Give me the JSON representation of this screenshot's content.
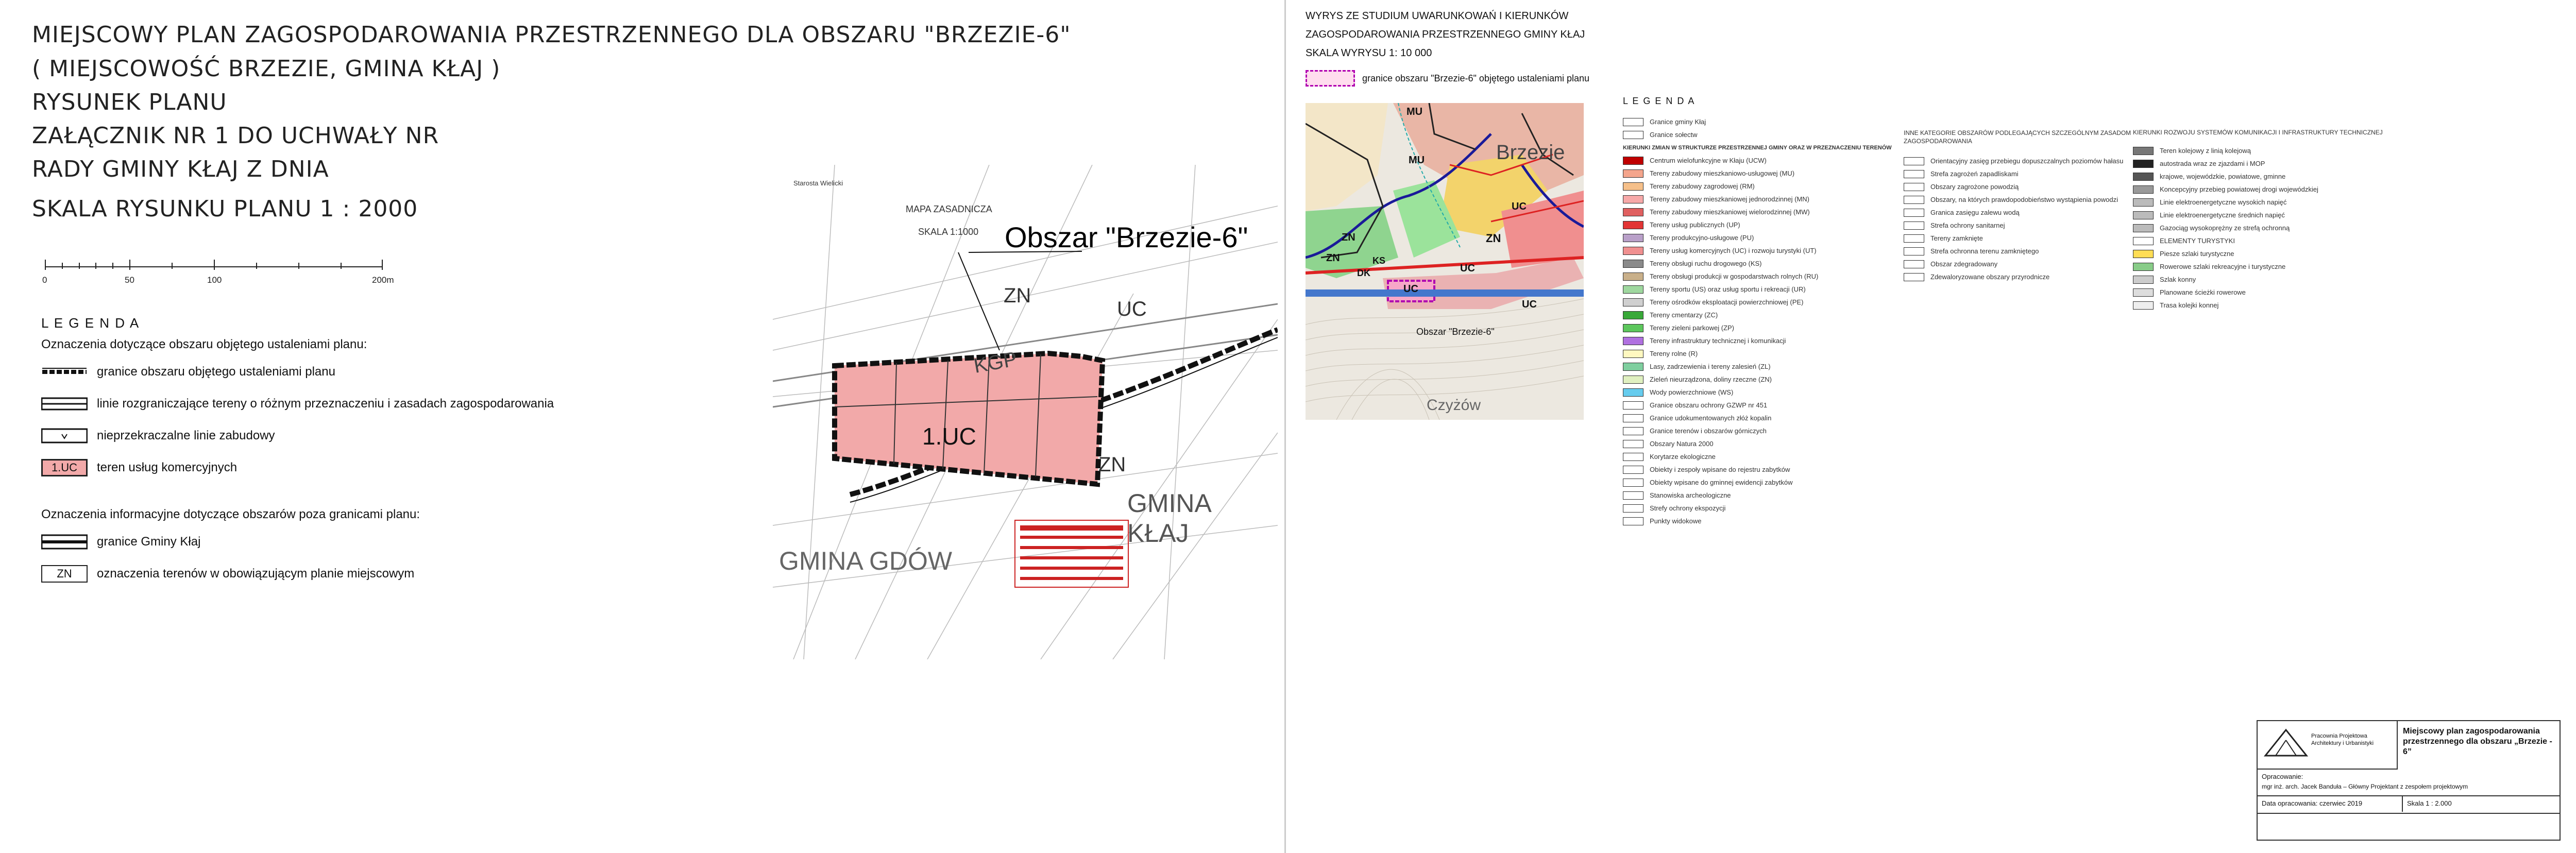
{
  "left_title": {
    "line1": "MIEJSCOWY PLAN ZAGOSPODAROWANIA PRZESTRZENNEGO  DLA OBSZARU \"BRZEZIE-6\"",
    "line2": "( MIEJSCOWOŚĆ BRZEZIE, GMINA KŁAJ )",
    "line3": "RYSUNEK PLANU",
    "line4": "ZAŁĄCZNIK NR 1 DO UCHWAŁY NR",
    "line5": "RADY GMINY KŁAJ Z DNIA",
    "line6": "SKALA RYSUNKU PLANU 1 : 2000"
  },
  "scale_bar": {
    "ticks": [
      "0",
      "50",
      "100",
      "200m"
    ]
  },
  "legend_left": {
    "heading": "L E G E N D A",
    "group1_title": "Oznaczenia dotyczące obszaru objętego ustaleniami planu:",
    "items1": [
      {
        "label": "granice obszaru objętego ustaleniami planu"
      },
      {
        "label": "linie rozgraniczające tereny o różnym przeznaczeniu i zasadach zagospodarowania"
      },
      {
        "label": "nieprzekraczalne linie zabudowy"
      },
      {
        "label": "teren usług komercyjnych",
        "code": "1.UC"
      }
    ],
    "group2_title": "Oznaczenia informacyjne dotyczące obszarów poza granicami planu:",
    "items2": [
      {
        "label": "granice Gminy Kłaj"
      },
      {
        "label": "oznaczenia terenów w obowiązującym planie miejscowym",
        "code": "ZN"
      }
    ]
  },
  "map_main": {
    "callout": "Obszar \"Brzezie-6\"",
    "zone_code": "1.UC",
    "labels": [
      "ZN",
      "UC",
      "KGP",
      "ZN",
      "GMINA KŁAJ",
      "GMINA GDÓW"
    ],
    "map_title": "MAPA ZASADNICZA",
    "map_scale": "SKALA 1:1000",
    "stamp_left": "Starosta Wielicki",
    "colors": {
      "zone_fill": "#f2a9a9",
      "boundary": "#111111",
      "red_stamp": "#cc2222"
    }
  },
  "right_title": {
    "line1": "WYRYS ZE STUDIUM UWARUNKOWAŃ I KIERUNKÓW",
    "line2": "ZAGOSPODAROWANIA PRZESTRZENNEGO GMINY KŁAJ",
    "line3": "SKALA  WYRYSU 1: 10 000",
    "boundary_label": "granice obszaru \"Brzezie-6\" objętego ustaleniami planu"
  },
  "excerpt_map": {
    "labels": [
      "MU",
      "MU",
      "Brzezie",
      "ZN",
      "ZN",
      "UC",
      "ZN",
      "UC",
      "UC",
      "UC",
      "Obszar \"Brzezie-6\"",
      "Czyżów",
      "DK",
      "KS"
    ]
  },
  "legend_right": {
    "heading": "L E G E N D A",
    "col1": [
      "Granice gminy Kłaj",
      "Granice sołectw",
      "KIERUNKI ZMIAN W STRUKTURZE PRZESTRZENNEJ GMINY ORAZ W PRZEZNACZENIU TERENÓW",
      "Centrum wielofunkcyjne w Kłaju (UCW)",
      "Tereny zabudowy mieszkaniowo-usługowej (MU)",
      "Tereny zabudowy zagrodowej (RM)",
      "Tereny zabudowy mieszkaniowej jednorodzinnej (MN)",
      "Tereny zabudowy mieszkaniowej wielorodzinnej (MW)",
      "Tereny usług publicznych (UP)",
      "Tereny produkcyjno-usługowe (PU)",
      "Tereny usług komercyjnych (UC) i rozwoju turystyki (UT)",
      "Tereny obsługi ruchu drogowego (KS)",
      "Tereny obsługi produkcji w gospodarstwach rolnych (RU)",
      "Tereny sportu (US) oraz usług sportu i rekreacji (UR)",
      "Tereny ośrodków eksploatacji powierzchniowej (PE)",
      "Tereny cmentarzy (ZC)",
      "Tereny zieleni parkowej (ZP)",
      "Tereny infrastruktury technicznej i komunikacji",
      "Tereny rolne (R)",
      "Lasy, zadrzewienia i tereny zalesień (ZL)",
      "Zieleń nieurządzona, doliny rzeczne (ZN)",
      "Wody powierzchniowe (WS)",
      "Granice obszaru ochrony GZWP nr 451",
      "Granice udokumentowanych złóż kopalin",
      "Granice terenów i obszarów górniczych",
      "Obszary Natura 2000",
      "Korytarze ekologiczne",
      "Obiekty i zespoły wpisane do rejestru zabytków",
      "Obiekty wpisane do gminnej ewidencji zabytków",
      "Stanowiska archeologiczne",
      "Strefy ochrony ekspozycji",
      "Punkty widokowe"
    ],
    "col2_head": "INNE KATEGORIE OBSZARÓW PODLEGAJĄCYCH SZCZEGÓLNYM ZASADOM ZAGOSPODAROWANIA",
    "col2": [
      "Orientacyjny zasięg przebiegu dopuszczalnych poziomów hałasu",
      "Strefa zagrożeń zapadliskami",
      "Obszary zagrożone powodzią",
      "Obszary, na których prawdopodobieństwo wystąpienia powodzi",
      "Granica zasięgu zalewu wodą",
      "Strefa ochrony sanitarnej",
      "Tereny zamknięte",
      "Strefa ochronna terenu zamkniętego",
      "Obszar zdegradowany",
      "Zdewaloryzowane obszary przyrodnicze"
    ],
    "col3_head": "KIERUNKI ROZWOJU SYSTEMÓW KOMUNIKACJI I INFRASTRUKTURY TECHNICZNEJ",
    "col3": [
      "Teren kolejowy z linią kolejową",
      "autostrada wraz ze zjazdami i MOP",
      "krajowe, wojewódzkie, powiatowe, gminne",
      "Koncepcyjny przebieg powiatowej drogi wojewódzkiej",
      "Linie elektroenergetyczne wysokich napięć",
      "Linie elektroenergetyczne średnich napięć",
      "Gazociąg wysokoprężny ze strefą ochronną",
      "ELEMENTY TURYSTYKI",
      "Piesze szlaki turystyczne",
      "Rowerowe szlaki rekreacyjne i turystyczne",
      "Szlak konny",
      "Planowane ścieżki rowerowe",
      "Trasa kolejki konnej"
    ]
  },
  "title_block": {
    "company": "Pracownia Projektowa Architektury i Urbanistyki",
    "project_title": "Miejscowy plan zagospodarowania przestrzennego dla obszaru „Brzezie - 6”",
    "prepared_label": "Opracowanie:",
    "authors": "mgr inż. arch. Jacek Banduła – Główny Projektant  z zespołem projektowym",
    "date": "Data opracowania: czerwiec 2019",
    "scale": "Skala   1 : 2.000"
  }
}
